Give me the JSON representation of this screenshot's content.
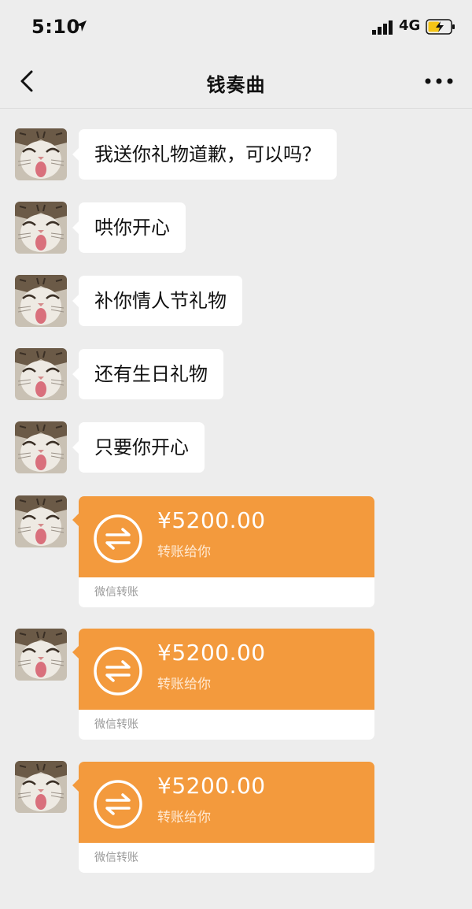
{
  "status_bar": {
    "time": "5:10",
    "network": "4G"
  },
  "nav": {
    "title": "钱奏曲"
  },
  "messages": [
    {
      "type": "text",
      "text": "我送你礼物道歉，可以吗？"
    },
    {
      "type": "text",
      "text": "哄你开心"
    },
    {
      "type": "text",
      "text": "补你情人节礼物"
    },
    {
      "type": "text",
      "text": "还有生日礼物"
    },
    {
      "type": "text",
      "text": "只要你开心"
    },
    {
      "type": "transfer",
      "amount": "¥5200.00",
      "note": "转账给你",
      "source": "微信转账"
    },
    {
      "type": "transfer",
      "amount": "¥5200.00",
      "note": "转账给你",
      "source": "微信转账"
    },
    {
      "type": "transfer",
      "amount": "¥5200.00",
      "note": "转账给你",
      "source": "微信转账"
    }
  ],
  "colors": {
    "transfer_orange": "#f39a3d",
    "bubble_white": "#ffffff",
    "background": "#ededed"
  }
}
